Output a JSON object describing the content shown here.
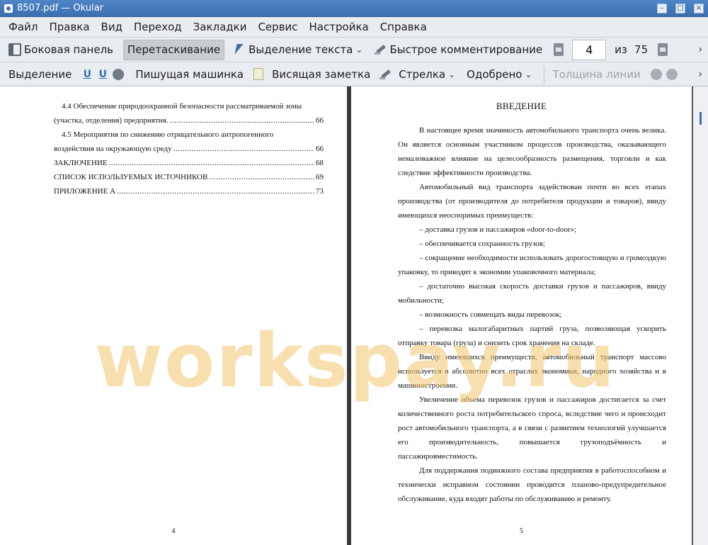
{
  "window": {
    "title": "8507.pdf  — Okular"
  },
  "menu": [
    "Файл",
    "Правка",
    "Вид",
    "Переход",
    "Закладки",
    "Сервис",
    "Настройка",
    "Справка"
  ],
  "toolbar1": {
    "sidebar": "Боковая панель",
    "drag": "Перетаскивание",
    "text_select": "Выделение текста",
    "quick_annot": "Быстрое комментирование",
    "page_value": "4",
    "of": "из",
    "page_total": "75"
  },
  "toolbar2": {
    "highlight": "Выделение",
    "typewriter": "Пишущая машинка",
    "note": "Висящая заметка",
    "arrow": "Стрелка",
    "stamp": "Одобрено",
    "line_width": "Толщина линии"
  },
  "left_page": {
    "toc": [
      {
        "title": "4.4 Обеспечение природоохранной безопасности рассматриваемой зоны",
        "cont": "(участка, отделения) предприятия.",
        "page": "66"
      },
      {
        "title": "4.5 Мероприятия по снижению отрицательного антропогенного",
        "cont": "воздействия на окружающую среду",
        "page": "66"
      },
      {
        "title": "ЗАКЛЮЧЕНИЕ",
        "page": "68"
      },
      {
        "title": "СПИСОК ИСПОЛЬЗУЕМЫХ ИСТОЧНИКОВ",
        "page": "69"
      },
      {
        "title": "ПРИЛОЖЕНИЕ А",
        "page": "73"
      }
    ],
    "number": "4"
  },
  "right_page": {
    "title": "ВВЕДЕНИЕ",
    "paragraphs": [
      "В настоящее время значимость автомобильного транспорта очень велика. Он является основным участником процессов производства, оказывающего немаловажное влияние на целесообразность размещения, торговли и как следствие эффективности производства.",
      "Автомобильный вид транспорта задействован почти во всех этапах производства (от производителя до потребителя продукции и товаров), ввиду имеющихся неоспоримых преимуществ:",
      "– доставка грузов и пассажиров «door-to-door»;",
      "– обеспечивается сохранность грузов;",
      "– сокращение необходимости использовать дорогостоящую и громоздкую упаковку, то приводит к экономии упаковочного материала;",
      "– достаточно высокая скорость доставки грузов и пассажиров, ввиду мобильности;",
      "– возможность совмещать виды перевозок;",
      "– перевозка малогабаритных партий груза, позволяющая ускорить отправку товара (груза) и снизить срок хранения на складе.",
      "Ввиду имеющихся преимуществ, автомобильный транспорт массово используется в абсолютно всех отраслях экономики, народного хозяйства и в машиностроении.",
      "Увеличение объема перевозок грузов и пассажиров достигается за счет количественного роста потребительского спроса, вследствие чего и происходит рост автомобильного транспорта, а в связи с развитием технологий улучшается его производительность, повышается грузоподъёмность и пассажировместимость.",
      "Для поддержания подвижного состава предприятия в работоспособном и технически исправном состоянии проводится планово-предупредительное обслуживание, куда входят работы по обслуживанию и ремонту."
    ],
    "number": "5"
  },
  "watermark": "workspay.ru"
}
